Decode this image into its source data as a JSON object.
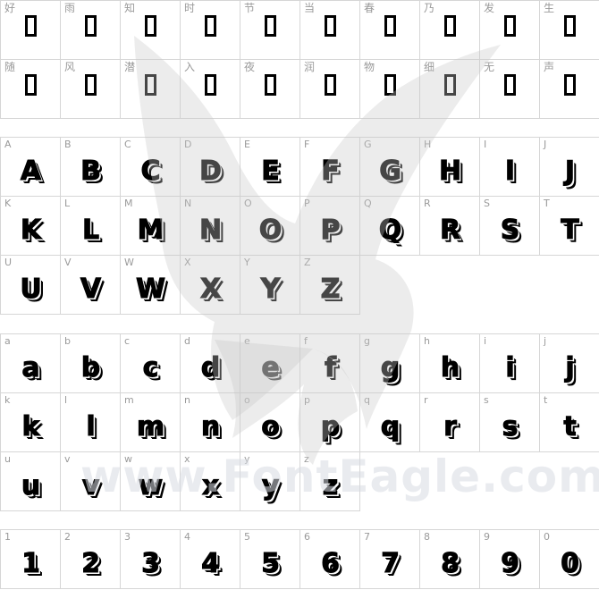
{
  "watermark": {
    "text": "www.FontEagle.com"
  },
  "sections": [
    {
      "id": "cjk",
      "rows": [
        [
          "好",
          "雨",
          "知",
          "时",
          "节",
          "当",
          "春",
          "乃",
          "发",
          "生"
        ],
        [
          "随",
          "风",
          "潜",
          "入",
          "夜",
          "润",
          "物",
          "细",
          "无",
          "声"
        ]
      ]
    },
    {
      "id": "uppercase",
      "rows": [
        [
          "A",
          "B",
          "C",
          "D",
          "E",
          "F",
          "G",
          "H",
          "I",
          "J"
        ],
        [
          "K",
          "L",
          "M",
          "N",
          "O",
          "P",
          "Q",
          "R",
          "S",
          "T"
        ],
        [
          "U",
          "V",
          "W",
          "X",
          "Y",
          "Z"
        ]
      ]
    },
    {
      "id": "lowercase",
      "rows": [
        [
          "a",
          "b",
          "c",
          "d",
          "e",
          "f",
          "g",
          "h",
          "i",
          "j"
        ],
        [
          "k",
          "l",
          "m",
          "n",
          "o",
          "p",
          "q",
          "r",
          "s",
          "t"
        ],
        [
          "u",
          "v",
          "w",
          "x",
          "y",
          "z"
        ]
      ]
    },
    {
      "id": "digits",
      "rows": [
        [
          "1",
          "2",
          "3",
          "4",
          "5",
          "6",
          "7",
          "8",
          "9",
          "0"
        ]
      ]
    }
  ]
}
